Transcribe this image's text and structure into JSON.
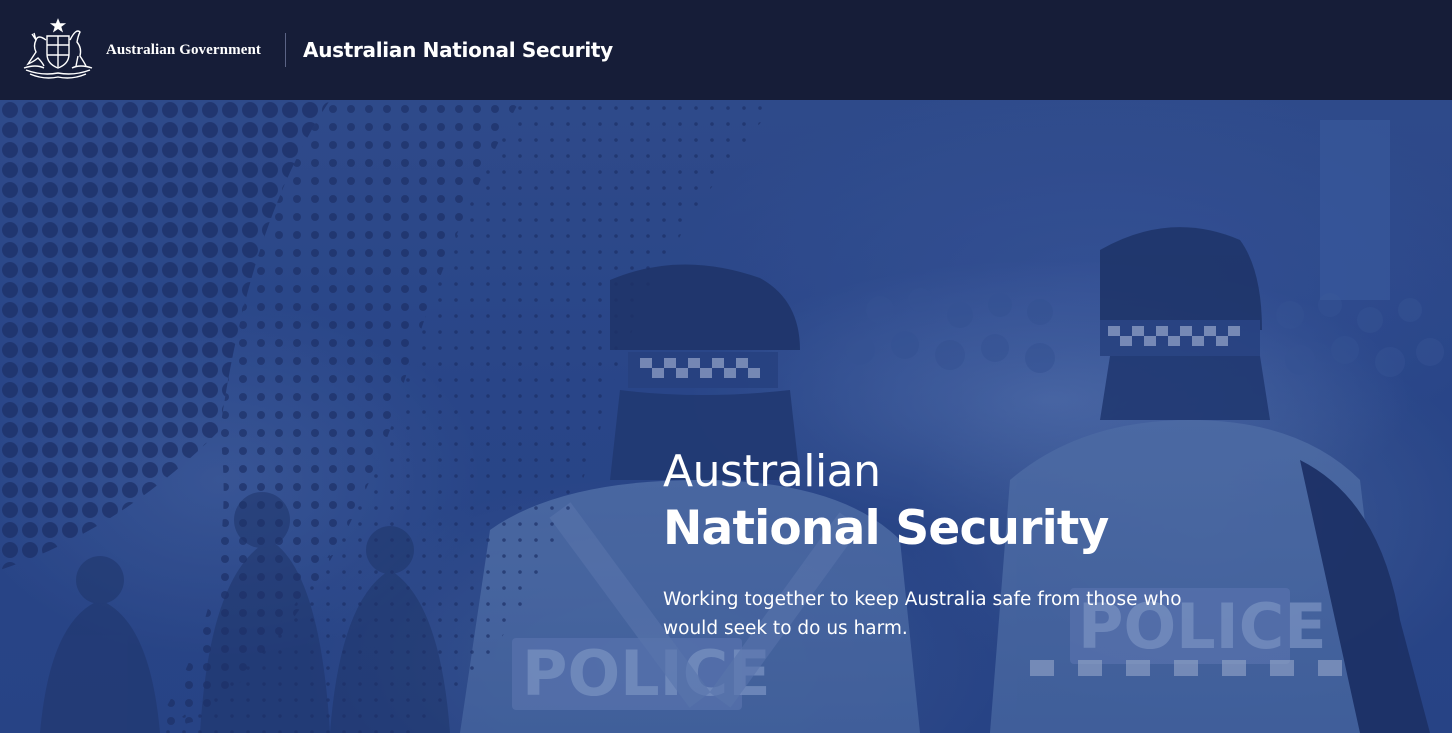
{
  "header": {
    "gov_label": "Australian Government",
    "site_title": "Australian National Security"
  },
  "hero": {
    "title_line1": "Australian",
    "title_line2": "National Security",
    "subtitle": "Working together to keep Australia safe from those who would seek to do us harm."
  },
  "colors": {
    "topbar_bg": "#161d38",
    "hero_overlay": "#2d4a8f",
    "text": "#ffffff"
  },
  "icons": {
    "crest": "commonwealth-coat-of-arms-icon",
    "hero_image": "police-officers-crowd-image"
  }
}
